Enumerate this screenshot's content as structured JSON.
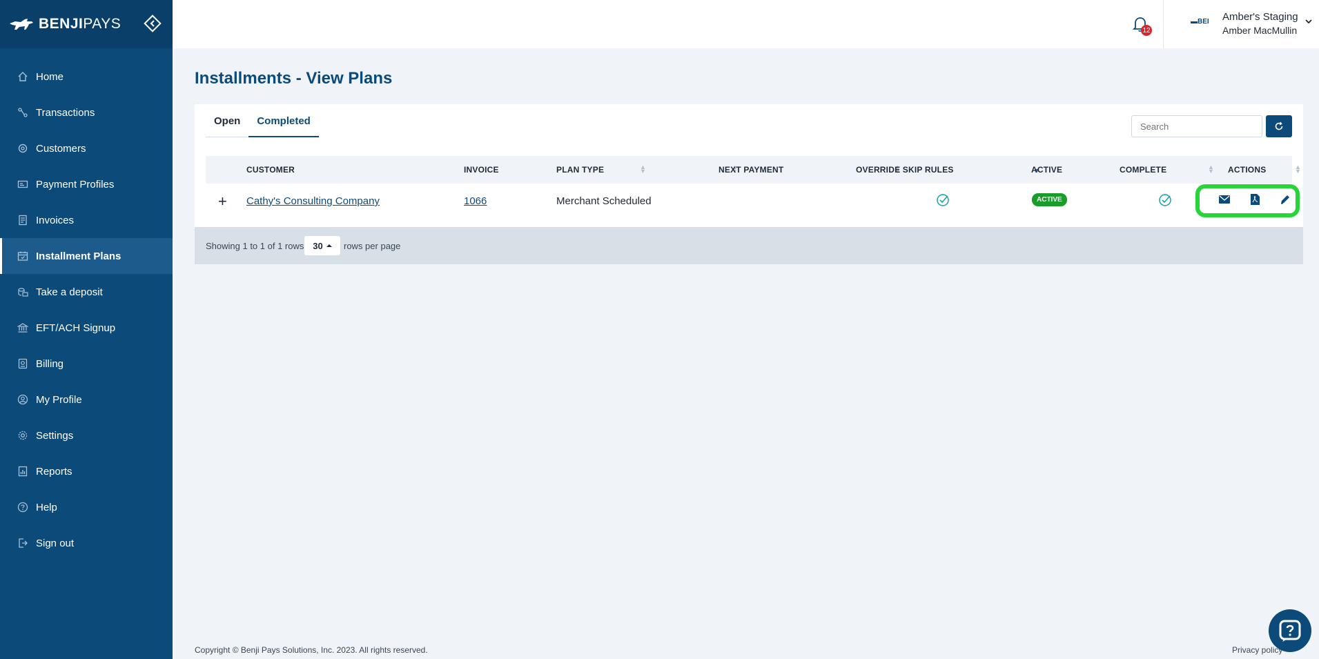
{
  "brand": {
    "logo_bold": "BENJI",
    "logo_light": "PAYS"
  },
  "sidebar": {
    "items": [
      {
        "label": "Home",
        "icon": "home-icon"
      },
      {
        "label": "Transactions",
        "icon": "transactions-icon"
      },
      {
        "label": "Customers",
        "icon": "customers-icon"
      },
      {
        "label": "Payment Profiles",
        "icon": "payment-profiles-icon"
      },
      {
        "label": "Invoices",
        "icon": "invoices-icon"
      },
      {
        "label": "Installment Plans",
        "icon": "calendar-icon",
        "active": true
      },
      {
        "label": "Take a deposit",
        "icon": "deposit-icon"
      },
      {
        "label": "EFT/ACH Signup",
        "icon": "bank-icon"
      },
      {
        "label": "Billing",
        "icon": "billing-icon"
      },
      {
        "label": "My Profile",
        "icon": "profile-icon"
      },
      {
        "label": "Settings",
        "icon": "gear-icon"
      },
      {
        "label": "Reports",
        "icon": "reports-icon"
      },
      {
        "label": "Help",
        "icon": "help-icon"
      },
      {
        "label": "Sign out",
        "icon": "sign-out-icon"
      }
    ]
  },
  "topbar": {
    "notification_count": "12",
    "account_logo_text": "BEI",
    "account_name": "Amber's Staging",
    "user_name": "Amber MacMullin"
  },
  "page": {
    "title": "Installments - View Plans"
  },
  "tabs": [
    {
      "label": "Open"
    },
    {
      "label": "Completed",
      "selected": true
    }
  ],
  "search": {
    "placeholder": "Search"
  },
  "table": {
    "headers": {
      "customer": "CUSTOMER",
      "invoice": "INVOICE",
      "plan_type": "PLAN TYPE",
      "next_payment": "NEXT PAYMENT",
      "override": "OVERRIDE SKIP RULES",
      "active": "ACTIVE",
      "complete": "COMPLETE",
      "actions": "ACTIONS"
    },
    "rows": [
      {
        "expand": "+",
        "customer": "Cathy's Consulting Company",
        "invoice": "1066",
        "plan_type": "Merchant Scheduled",
        "next_payment": "",
        "override_skip_rules": true,
        "active_badge": "ACTIVE",
        "complete": true,
        "actions": [
          "email-icon",
          "pdf-icon",
          "edit-icon"
        ]
      }
    ]
  },
  "pagination": {
    "showing": "Showing 1 to 1 of 1 rows",
    "per_page": "30",
    "per_page_label": "rows per page"
  },
  "footer": {
    "copyright": "Copyright © Benji Pays Solutions, Inc. 2023. All rights reserved.",
    "privacy": "Privacy policy"
  },
  "colors": {
    "sidebar": "#0c4a7a",
    "accent": "#0c4a7a",
    "active_badge": "#1a9c2b",
    "highlight_ring": "#27d53a",
    "notification_badge": "#d7262e"
  }
}
